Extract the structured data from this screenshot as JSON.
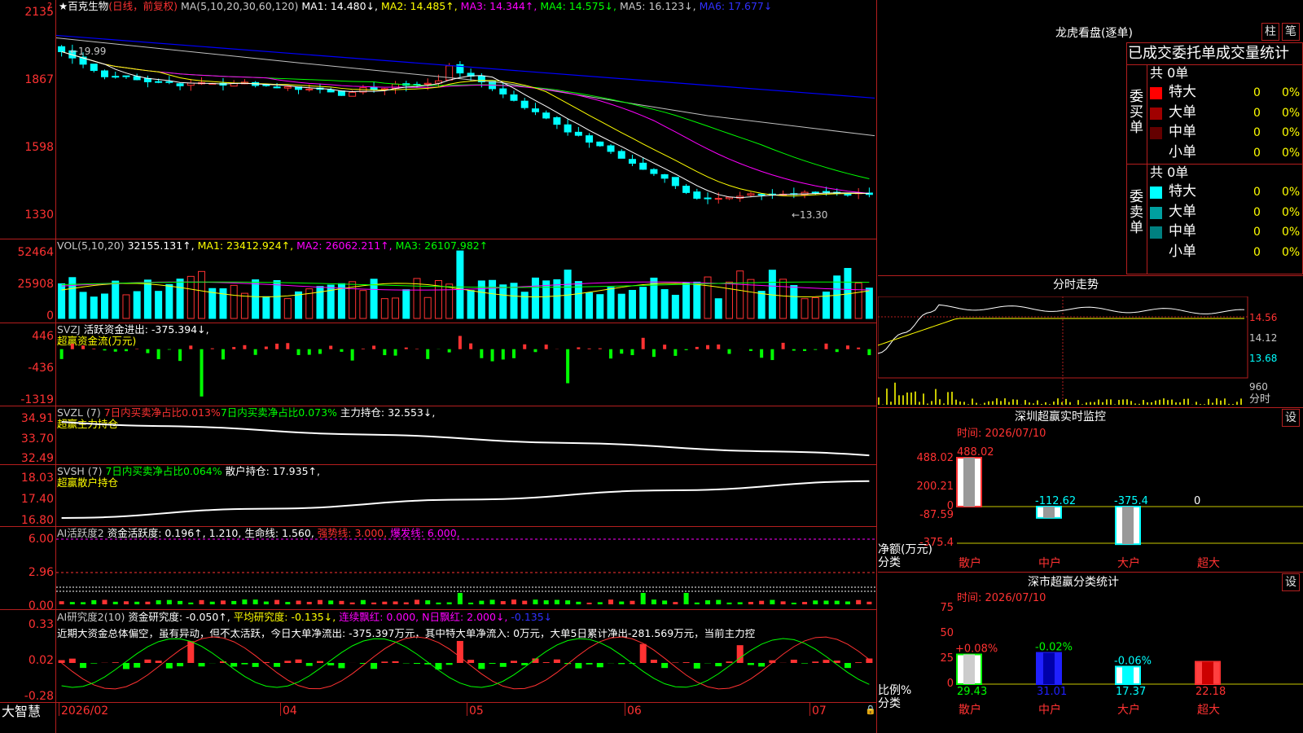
{
  "colors": {
    "up": "#ff3232",
    "down": "#00ffff",
    "frame": "#b41e1e",
    "ma1": "#ffffff",
    "ma2": "#ffff00",
    "ma3": "#ff00ff",
    "ma4": "#00ff00",
    "ma5": "#c0c0c0",
    "ma6": "#0000ff"
  },
  "price_panel": {
    "stock": "★百克生物",
    "period": "(日线，前复权)",
    "ma_params": "MA(5,10,20,30,60,120)",
    "ma": [
      "MA1: 14.480↓,",
      "MA2: 14.485↑,",
      "MA3: 14.344↑,",
      "MA4: 14.575↓,",
      "MA5: 16.123↓,",
      "MA6: 17.677↓"
    ],
    "high_mark": "←19.99",
    "low_mark": "←13.30",
    "yticks": [
      "2135",
      "1867",
      "1598",
      "1330"
    ]
  },
  "vol_panel": {
    "title": "VOL(5,10,20)",
    "val": "32155.131↑,",
    "ma1": "MA1: 23412.924↑,",
    "ma2": "MA2: 26062.211↑,",
    "ma3": "MA3: 26107.982↑",
    "yticks": [
      "52464",
      "25908",
      "0"
    ]
  },
  "svzj_panel": {
    "title": "SVZJ",
    "active": "活跃资金进出: -375.394↓,",
    "sub": "超赢资金流(万元)",
    "yticks": [
      "446",
      "-436",
      "-1319"
    ]
  },
  "svzl_panel": {
    "title": "SVZL (7)",
    "ratio1": "7日内买卖净占比0.013%",
    "ratio2": "7日内买卖净占比0.073%",
    "main": "主力持仓: 32.553↓,",
    "sub": "超赢主力持仓",
    "yticks": [
      "34.91",
      "33.70",
      "32.49"
    ]
  },
  "svsh_panel": {
    "title": "SVSH (7)",
    "ratio": "7日内买卖净占比0.064%",
    "retail": "散户持仓: 17.935↑,",
    "sub": "超赢散户持仓",
    "yticks": [
      "18.03",
      "17.40",
      "16.80"
    ]
  },
  "ai2_panel": {
    "title": "AI活跃度2",
    "a": "资金活跃度: 0.196↑,",
    "b": "1.210,",
    "c": "生命线: 1.560,",
    "d": "强势线: 3.000,",
    "e": "爆发线: 6.000,",
    "yticks": [
      "6.00",
      "2.96",
      "0.00"
    ]
  },
  "ai_res_panel": {
    "title": "AI研究度2(10)",
    "a": "资金研究度: -0.050↑,",
    "b": "平均研究度: -0.135↓,",
    "c": "连续飘红: 0.000,",
    "d": "N日飘红: 2.000↓,",
    "e": "-0.135↓",
    "comment": "近期大资金总体偏空，虽有异动，但不太活跃，今日大单净流出: -375.397万元，其中特大单净流入: 0万元，大单5日累计净出-281.569万元，当前主力控",
    "yticks": [
      "0.33",
      "0.02",
      "-0.28"
    ]
  },
  "xaxis": {
    "brand": "大智慧",
    "labels": [
      "2026/02",
      "04",
      "05",
      "06",
      "07"
    ]
  },
  "lhb": {
    "title": "龙虎看盘(逐单)",
    "btn_zhu": "柱",
    "btn_bi": "笔",
    "tabs": "已成交委托单成交量统计",
    "buy": {
      "side": "委\n买\n单",
      "total": "共 0单",
      "rows": [
        {
          "n": "特大",
          "v": "0",
          "p": "0%",
          "c": "#ff0000"
        },
        {
          "n": "大单",
          "v": "0",
          "p": "0%",
          "c": "#a00000"
        },
        {
          "n": "中单",
          "v": "0",
          "p": "0%",
          "c": "#640000"
        },
        {
          "n": "小单",
          "v": "0",
          "p": "0%",
          "c": ""
        }
      ]
    },
    "sell": {
      "side": "委\n卖\n单",
      "total": "共 0单",
      "rows": [
        {
          "n": "特大",
          "v": "0",
          "p": "0%",
          "c": "#00ffff"
        },
        {
          "n": "大单",
          "v": "0",
          "p": "0%",
          "c": "#00a0a0"
        },
        {
          "n": "中单",
          "v": "0",
          "p": "0%",
          "c": "#008080"
        },
        {
          "n": "小单",
          "v": "0",
          "p": "0%",
          "c": ""
        }
      ]
    }
  },
  "fenshi": {
    "title": "分时走势",
    "yticks": [
      "14.56",
      "14.12",
      "13.68"
    ],
    "vol_tick": "960",
    "label": "分时"
  },
  "sz_monitor": {
    "title": "深圳超赢实时监控",
    "btn": "设",
    "time": "时间: 2026/07/10",
    "yticks": [
      "488.02",
      "200.21",
      "0",
      "-87.59",
      "-375.4"
    ],
    "ylabel": "净额(万元)",
    "cat_label": "分类",
    "cats": [
      "散户",
      "中户",
      "大户",
      "超大"
    ],
    "values": [
      488.02,
      -112.62,
      -375.4,
      0
    ],
    "value_labels": [
      "488.02",
      "-112.62",
      "-375.4",
      "0"
    ]
  },
  "sz_class": {
    "title": "深市超赢分类统计",
    "btn": "设",
    "time": "时间: 2026/07/10",
    "yticks": [
      "75",
      "50",
      "25",
      "0"
    ],
    "ylabel": "比例%",
    "cat_label": "分类",
    "cats": [
      "散户",
      "中户",
      "大户",
      "超大"
    ],
    "values": [
      29.43,
      31.01,
      17.37,
      22.18
    ],
    "value_labels": [
      "29.43",
      "31.01",
      "17.37",
      "22.18"
    ],
    "deltas": [
      "+0.08%",
      "-0.02%",
      "-0.06%",
      ""
    ]
  }
}
